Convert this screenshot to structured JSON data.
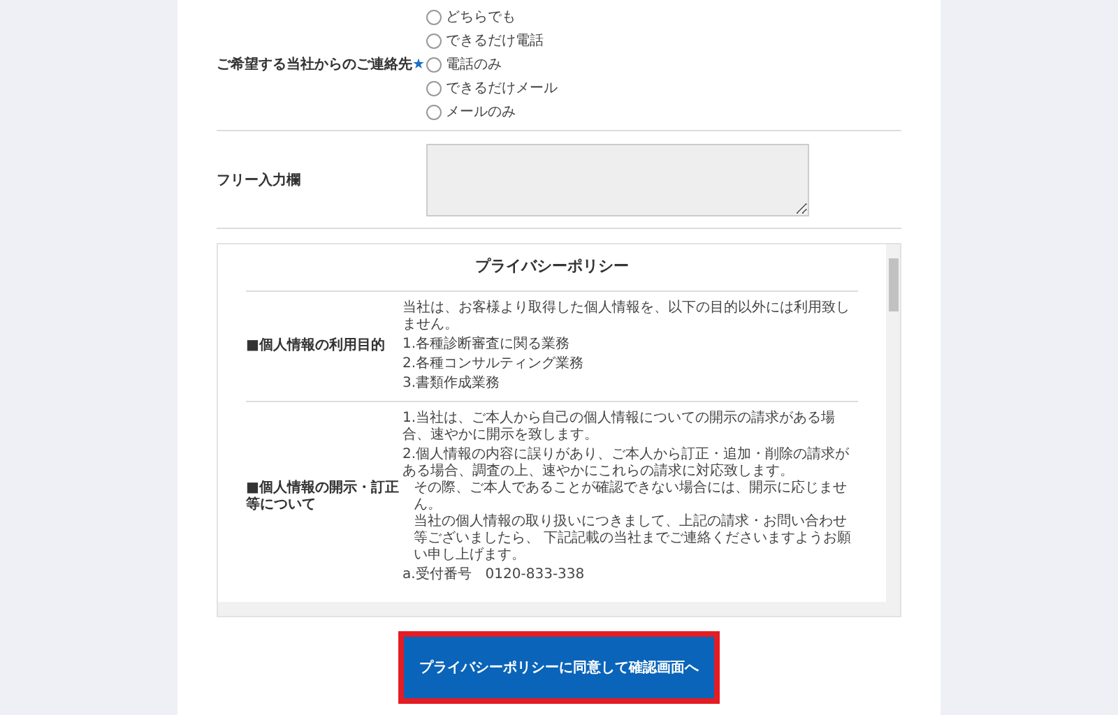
{
  "contact_preference": {
    "label": "ご希望する当社からのご連絡先",
    "required_mark": "★",
    "options": [
      {
        "label": "どちらでも",
        "selected": false
      },
      {
        "label": "できるだけ電話",
        "selected": false
      },
      {
        "label": "電話のみ",
        "selected": false
      },
      {
        "label": "できるだけメール",
        "selected": false
      },
      {
        "label": "メールのみ",
        "selected": false
      }
    ]
  },
  "free_input": {
    "label": "フリー入力欄"
  },
  "privacy_policy": {
    "title": "プライバシーポリシー",
    "sections": [
      {
        "heading": "■個人情報の利用目的",
        "items": [
          {
            "text": "当社は、お客様より取得した個人情報を、以下の目的以外には利用致しません。"
          },
          {
            "text": "1.各種診断審査に関る業務"
          },
          {
            "text": "2.各種コンサルティング業務"
          },
          {
            "text": "3.書類作成業務"
          }
        ]
      },
      {
        "heading": "■個人情報の開示・訂正等について",
        "items": [
          {
            "text": "1.当社は、ご本人から自己の個人情報についての開示の請求がある場合、速やかに開示を致します。"
          },
          {
            "text": "2.個人情報の内容に誤りがあり、ご本人から訂正・追加・削除の請求がある場合、調査の上、速やかにこれらの請求に対応致します。",
            "lines": [
              "その際、ご本人であることが確認できない場合には、開示に応じません。",
              "当社の個人情報の取り扱いにつきまして、上記の請求・お問い合わせ等ございましたら、 下記記載の当社までご連絡くださいますようお願い申し上げます。"
            ]
          },
          {
            "text": "a.受付番号　0120-833-338"
          }
        ]
      }
    ]
  },
  "submit_button": {
    "label": "プライバシーポリシーに同意して確認画面へ"
  }
}
